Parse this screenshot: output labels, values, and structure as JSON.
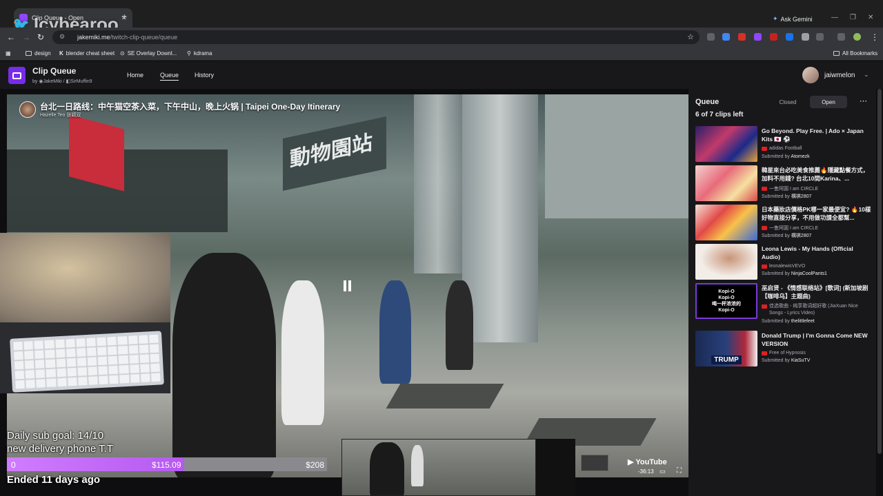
{
  "browser": {
    "tab_title": "Clip Queue - Open",
    "url_host": "jakemiki.me",
    "url_path": "/twitch-clip-queue/queue",
    "ask_gemini": "Ask Gemini",
    "bookmarks": [
      "design",
      "blender cheat sheet",
      "SE Overlay Downl...",
      "kdrama"
    ],
    "all_bookmarks": "All Bookmarks"
  },
  "watermark": "Icybearoo",
  "app": {
    "title": "Clip Queue",
    "by_prefix": "by",
    "author1": "JakeMiki",
    "author2": "SirMuffin9",
    "nav": [
      "Home",
      "Queue",
      "History"
    ],
    "username": "jaiwmelon"
  },
  "player": {
    "video_title": "台北一日路线：中午猫空茶入菜，下午中山，晚上火锅 | Taipei One-Day Itinerary",
    "channel": "Hazelle Teo 张颖双",
    "sign_text": "動物園站",
    "youtube_label": "YouTube",
    "timecode": "-36:13"
  },
  "overlay": {
    "sub_goal_line1": "Daily sub goal: 14/10",
    "sub_goal_line2": "new delivery phone T.T",
    "goal_min": "0",
    "goal_current": "$115.09",
    "goal_max": "$208",
    "goal_progress": 0.553,
    "ended": "Ended 11 days ago"
  },
  "queue": {
    "title": "Queue",
    "count": "6 of 7 clips left",
    "closed_label": "Closed",
    "open_label": "Open",
    "submitted_prefix": "Submitted by",
    "clips": [
      {
        "title": "Go Beyond. Play Free. | Ado × Japan Kits 🇯🇵 ⚽",
        "channel": "adidas Football",
        "submitter": "Atomezk"
      },
      {
        "title": "韓星來台必吃美食推薦🔥隱藏點餐方式，加料不用錢? 台北10間Karina、...",
        "channel": "一隻阿圓 I am CIRCLE",
        "submitter": "構祺2807"
      },
      {
        "title": "日本藥妝店價格PK哪一家最便宜? 🔥10樣好物直接分享，不用做功課全都幫...",
        "channel": "一隻阿圓 I am CIRCLE",
        "submitter": "構祺2807"
      },
      {
        "title": "Leona Lewis - My Hands (Official Audio)",
        "channel": "leonalewisVEVO",
        "submitter": "NinjaCoolPants1"
      },
      {
        "title": "巫启贤 - 《情感联络站》[歌词] (新加坡剧【咖啡乌】主题曲)",
        "channel": "佳选歌曲 - 纯享歌词超好歌 (JiaXuan Nice Songs - Lyrics Video)",
        "submitter": "thelittlefeet"
      },
      {
        "title": "Donald Trump | I'm Gonna Come NEW VERSION",
        "channel": "Free of Hypnosis",
        "submitter": "KiaSuTV"
      }
    ],
    "thumb4_lines": [
      "Kopi-O",
      "Kopi-O",
      "喝一杯浓浓的",
      "Kopi-O"
    ],
    "thumb6_text": "TRUMP"
  }
}
